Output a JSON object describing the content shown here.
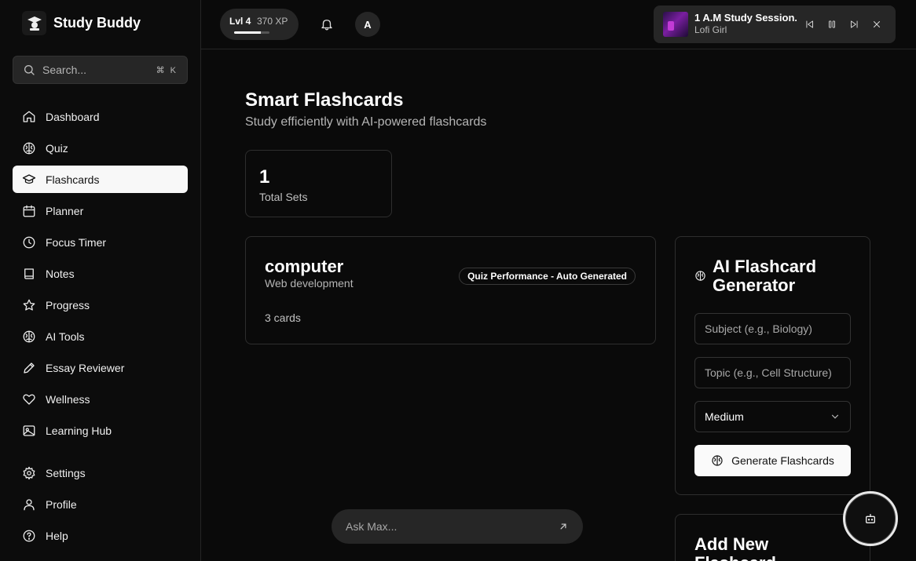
{
  "app": {
    "name": "Study Buddy"
  },
  "search": {
    "placeholder": "Search...",
    "shortcut": "⌘ K"
  },
  "nav": {
    "main": [
      {
        "label": "Dashboard",
        "icon": "home-icon"
      },
      {
        "label": "Quiz",
        "icon": "brain-icon"
      },
      {
        "label": "Flashcards",
        "icon": "graduation-cap-icon",
        "active": true
      },
      {
        "label": "Planner",
        "icon": "calendar-icon"
      },
      {
        "label": "Focus Timer",
        "icon": "clock-icon"
      },
      {
        "label": "Notes",
        "icon": "book-icon"
      },
      {
        "label": "Progress",
        "icon": "star-icon"
      },
      {
        "label": "AI Tools",
        "icon": "brain-icon"
      },
      {
        "label": "Essay Reviewer",
        "icon": "pencil-icon"
      },
      {
        "label": "Wellness",
        "icon": "heart-icon"
      },
      {
        "label": "Learning Hub",
        "icon": "image-icon"
      }
    ],
    "bottom": [
      {
        "label": "Settings",
        "icon": "gear-icon"
      },
      {
        "label": "Profile",
        "icon": "user-icon"
      },
      {
        "label": "Help",
        "icon": "help-circle-icon"
      }
    ]
  },
  "topbar": {
    "level": "Lvl 4",
    "xp": "370 XP",
    "xp_progress": 0.75,
    "avatar_initial": "A"
  },
  "player": {
    "track": "1 A.M Study Session...",
    "artist": "Lofi Girl"
  },
  "page": {
    "title": "Smart Flashcards",
    "subtitle": "Study efficiently with AI-powered flashcards"
  },
  "stats": {
    "total_sets_value": "1",
    "total_sets_label": "Total Sets"
  },
  "flashcard_set": {
    "title": "computer",
    "subject": "Web development",
    "badge": "Quiz Performance - Auto Generated",
    "count": "3 cards"
  },
  "generator": {
    "title": "AI Flashcard Generator",
    "subject_placeholder": "Subject (e.g., Biology)",
    "topic_placeholder": "Topic (e.g., Cell Structure)",
    "difficulty": "Medium",
    "button": "Generate Flashcards"
  },
  "add_card": {
    "title": "Add New Flashcard"
  },
  "assistant": {
    "placeholder": "Ask Max..."
  },
  "colors": {
    "background": "#0a0a0a",
    "surface": "#262626",
    "border": "#2e2e2e",
    "active_nav": "#f8f8f8"
  }
}
